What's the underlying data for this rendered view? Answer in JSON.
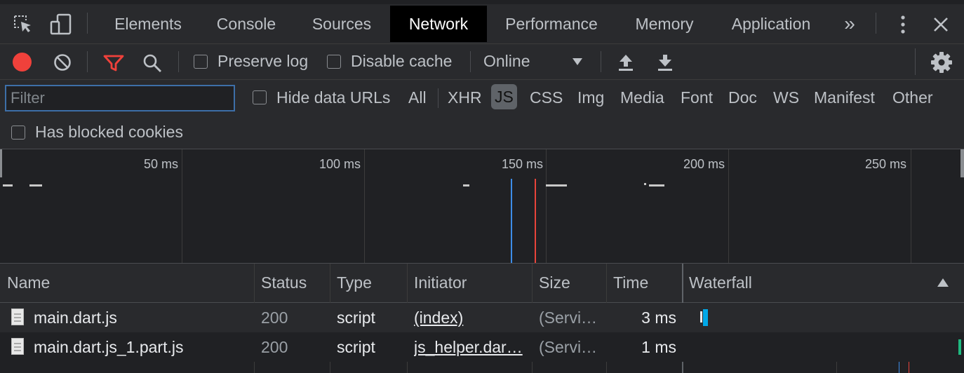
{
  "tabs": [
    {
      "label": "Elements"
    },
    {
      "label": "Console"
    },
    {
      "label": "Sources"
    },
    {
      "label": "Network"
    },
    {
      "label": "Performance"
    },
    {
      "label": "Memory"
    },
    {
      "label": "Application"
    }
  ],
  "tabs_more_glyph": "»",
  "toolbar": {
    "preserve_log": "Preserve log",
    "disable_cache": "Disable cache",
    "throttle_value": "Online"
  },
  "filter": {
    "placeholder": "Filter",
    "hide_data_urls": "Hide data URLs",
    "types": [
      "All",
      "XHR",
      "JS",
      "CSS",
      "Img",
      "Media",
      "Font",
      "Doc",
      "WS",
      "Manifest",
      "Other"
    ],
    "selected_type": "JS",
    "has_blocked_cookies": "Has blocked cookies"
  },
  "overview": {
    "ticks": [
      "50 ms",
      "100 ms",
      "150 ms",
      "200 ms",
      "250 ms"
    ],
    "dom_content_loaded_color": "#3d8de8",
    "load_color": "#e8443b"
  },
  "table": {
    "columns": [
      "Name",
      "Status",
      "Type",
      "Initiator",
      "Size",
      "Time",
      "Waterfall"
    ],
    "rows": [
      {
        "name": "main.dart.js",
        "status": "200",
        "type": "script",
        "initiator": "(index)",
        "size": "(Servi…",
        "time": "3 ms"
      },
      {
        "name": "main.dart.js_1.part.js",
        "status": "200",
        "type": "script",
        "initiator": "js_helper.dar…",
        "size": "(Servi…",
        "time": "1 ms"
      }
    ]
  },
  "colors": {
    "record": "#f0413b",
    "filter_active": "#f0413b",
    "selected_tab_bg": "#000000",
    "waterfall_bar": "#00a8e8"
  }
}
